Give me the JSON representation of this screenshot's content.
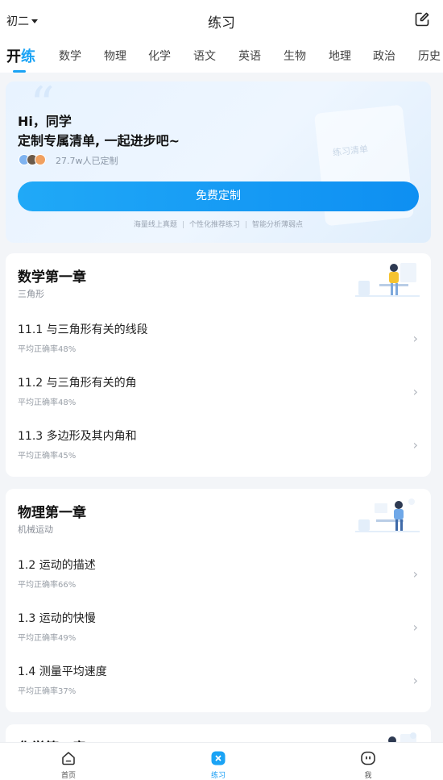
{
  "header": {
    "grade": "初二",
    "title": "练习"
  },
  "subjects": {
    "logo_part1": "开",
    "logo_part2": "练",
    "items": [
      "数学",
      "物理",
      "化学",
      "语文",
      "英语",
      "生物",
      "地理",
      "政治",
      "历史"
    ]
  },
  "promo": {
    "greeting": "Hi，同学",
    "slogan": "定制专属清单, 一起进步吧~",
    "count": "27.7w人已定制",
    "cta": "免费定制",
    "decor_tag": "练习清单",
    "features": [
      "海量线上真题",
      "个性化推荐练习",
      "智能分析薄弱点"
    ]
  },
  "chapters": [
    {
      "title": "数学第一章",
      "subtitle": "三角形",
      "sections": [
        {
          "name": "11.1 与三角形有关的线段",
          "accuracy": "平均正确率48%"
        },
        {
          "name": "11.2 与三角形有关的角",
          "accuracy": "平均正确率48%"
        },
        {
          "name": "11.3 多边形及其内角和",
          "accuracy": "平均正确率45%"
        }
      ]
    },
    {
      "title": "物理第一章",
      "subtitle": "机械运动",
      "sections": [
        {
          "name": "1.2 运动的描述",
          "accuracy": "平均正确率66%"
        },
        {
          "name": "1.3 运动的快慢",
          "accuracy": "平均正确率49%"
        },
        {
          "name": "1.4 测量平均速度",
          "accuracy": "平均正确率37%"
        }
      ]
    },
    {
      "title": "化学第一章",
      "subtitle": "",
      "sections": []
    }
  ],
  "bottom_nav": [
    {
      "label": "首页",
      "icon": "home-icon"
    },
    {
      "label": "练习",
      "icon": "practice-icon"
    },
    {
      "label": "我",
      "icon": "profile-icon"
    }
  ],
  "colors": {
    "accent": "#1aa3f5",
    "background": "#f3f5f8"
  }
}
